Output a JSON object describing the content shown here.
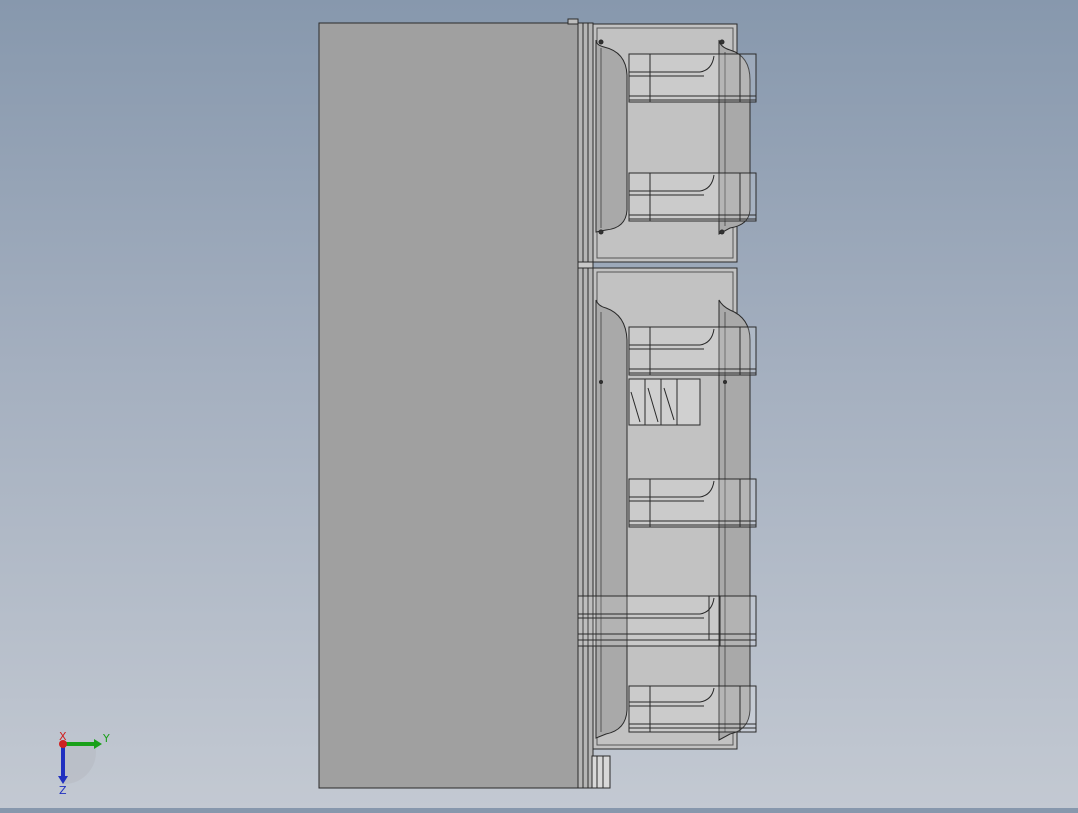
{
  "viewport": {
    "background_top": "#8798ad",
    "background_bottom": "#c3c9d2",
    "model": {
      "body_fill": "#a0a0a0",
      "door_fill": "#c2c2c2",
      "edge_color": "#2a2a2a",
      "line_color": "#3a3a3a"
    }
  },
  "triad": {
    "x_label": "X",
    "y_label": "Y",
    "z_label": "Z",
    "x_color": "#d02020",
    "y_color": "#19a019",
    "z_color": "#2030c0"
  }
}
